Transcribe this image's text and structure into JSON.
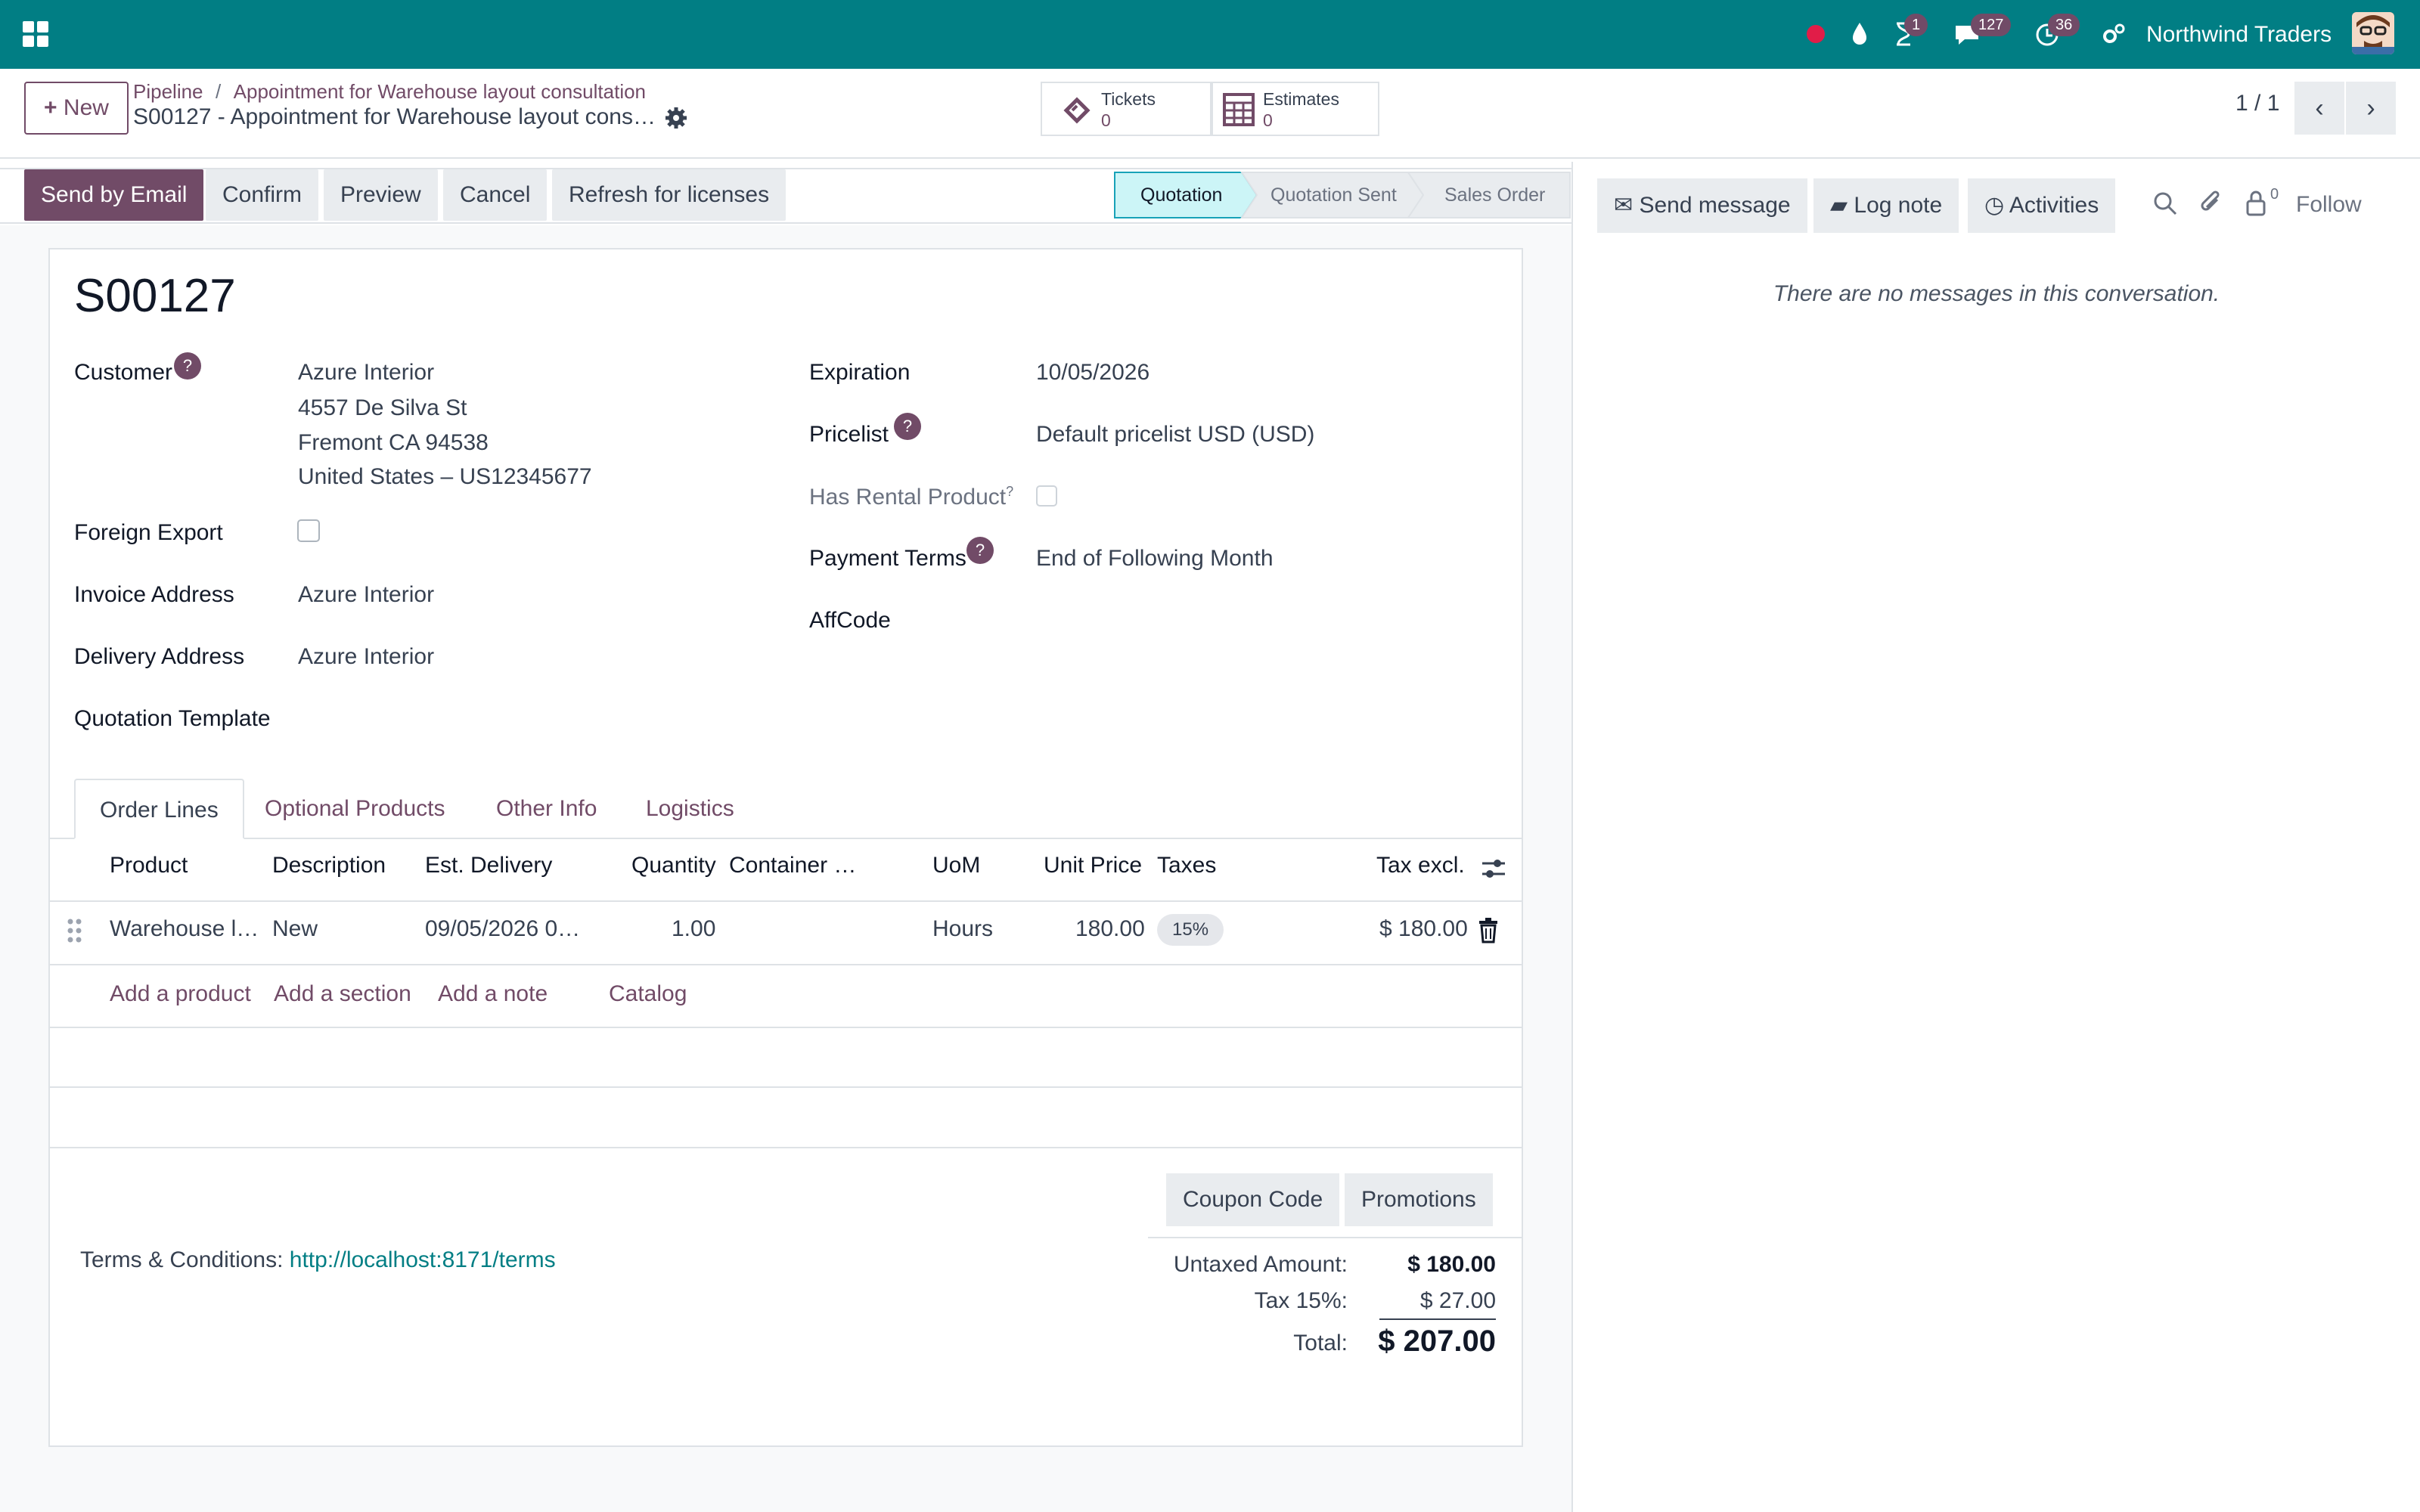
{
  "topbar": {
    "company": "Northwind Traders",
    "badges": {
      "activities_timer": "1",
      "messages": "127",
      "clock": "36"
    },
    "accent": "#017e84"
  },
  "control": {
    "new_label": "New",
    "breadcrumb": [
      "Pipeline",
      "Appointment for Warehouse layout consultation"
    ],
    "record_title": "S00127 - Appointment for Warehouse layout cons…",
    "stats": [
      {
        "label": "Tickets",
        "value": "0"
      },
      {
        "label": "Estimates",
        "value": "0"
      }
    ],
    "pager": "1 / 1"
  },
  "actions": [
    "Send by Email",
    "Confirm",
    "Preview",
    "Cancel",
    "Refresh for licenses"
  ],
  "stages": [
    "Quotation",
    "Quotation Sent",
    "Sales Order"
  ],
  "form": {
    "name": "S00127",
    "left": {
      "customer_label": "Customer",
      "customer_lines": [
        "Azure Interior",
        "4557 De Silva St",
        "Fremont CA 94538",
        "United States – US12345677"
      ],
      "foreign_export_label": "Foreign Export",
      "invoice_label": "Invoice Address",
      "invoice_value": "Azure Interior",
      "delivery_label": "Delivery Address",
      "delivery_value": "Azure Interior",
      "template_label": "Quotation Template"
    },
    "right": {
      "expiration_label": "Expiration",
      "expiration_value": "10/05/2026",
      "pricelist_label": "Pricelist",
      "pricelist_value": "Default pricelist USD  (USD)",
      "rental_label": "Has Rental Product",
      "payment_label": "Payment Terms",
      "payment_value": "End of Following Month",
      "affcode_label": "AffCode"
    },
    "help_glyph": "?"
  },
  "tabs": [
    "Order Lines",
    "Optional Products",
    "Other Info",
    "Logistics"
  ],
  "order_lines": {
    "headers": [
      "Product",
      "Description",
      "Est. Delivery",
      "Quantity",
      "Container …",
      "UoM",
      "Unit Price",
      "Taxes",
      "Tax excl."
    ],
    "row": {
      "product": "Warehouse l…",
      "description": "New",
      "delivery": "09/05/2026 0…",
      "quantity": "1.00",
      "uom": "Hours",
      "unit_price": "180.00",
      "tax": "15%",
      "subtotal": "$ 180.00"
    },
    "add_links": [
      "Add a product",
      "Add a section",
      "Add a note",
      "Catalog"
    ]
  },
  "footer": {
    "coupon_label": "Coupon Code",
    "promotions_label": "Promotions",
    "terms_label": "Terms & Conditions:",
    "terms_link": "http://localhost:8171/terms",
    "untaxed_label": "Untaxed Amount:",
    "untaxed_value": "$ 180.00",
    "tax_label": "Tax 15%:",
    "tax_value": "$ 27.00",
    "total_label": "Total:",
    "total_value": "$ 207.00"
  },
  "chatter": {
    "send_message": "Send message",
    "log_note": "Log note",
    "activities": "Activities",
    "followers_count": "0",
    "follow": "Follow",
    "empty": "There are no messages in this conversation."
  }
}
